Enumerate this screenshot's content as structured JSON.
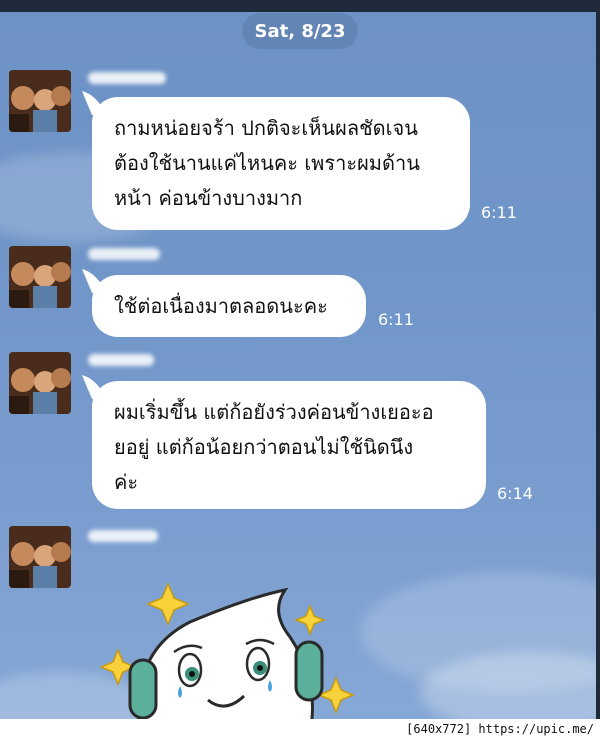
{
  "header": {
    "date": "Sat, 8/23"
  },
  "messages": [
    {
      "text": "ถามหน่อยจร้า ปกติจะเห็นผลชัดเจน\nต้องใช้นานแค่ไหนคะ เพราะผมด้าน\nหน้า ค่อนข้างบางมาก",
      "time": "6:11"
    },
    {
      "text": "ใช้ต่อเนื่องมาตลอดนะคะ",
      "time": "6:11"
    },
    {
      "text": "ผมเริ่มขึ้น แต่ก้อยังร่วงค่อนข้างเยอะอ\nยอยู่ แต่ก้อน้อยกว่าตอนไม่ใช้นิดนึง\nค่ะ",
      "time": "6:14"
    }
  ],
  "footer": {
    "watermark": "[640x772] https://upic.me/"
  },
  "colors": {
    "background": "#7196c9",
    "bubble": "#ffffff",
    "time": "#ffffff"
  },
  "sticker": {
    "icon": "sparkle-ghost-headphones-sticker"
  }
}
